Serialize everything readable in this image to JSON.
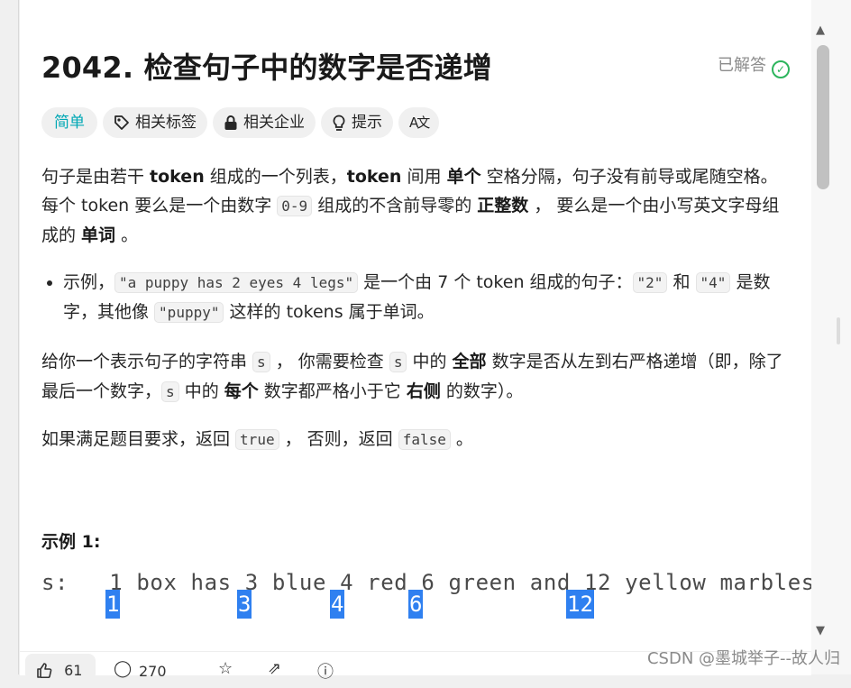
{
  "problem": {
    "title": "2042. 检查句子中的数字是否递增",
    "status": "已解答"
  },
  "tags": {
    "difficulty": "简单",
    "topics": "相关标签",
    "companies": "相关企业",
    "hint": "提示",
    "translate_glyph": "A文"
  },
  "description": {
    "p1": {
      "a": "句子是由若干 ",
      "b": "token",
      "c": " 组成的一个列表，",
      "d": "token",
      "e": " 间用 ",
      "f": "单个",
      "g": " 空格分隔，句子没有前导或尾随空格。每个 token 要么是一个由数字 ",
      "h": "0-9",
      "i": " 组成的不含前导零的 ",
      "j": "正整数",
      "k": " ， 要么是一个由小写英文字母组成的 ",
      "l": "单词",
      "m": " 。"
    },
    "bullet": {
      "a": "示例，",
      "b": "\"a puppy has 2 eyes 4 legs\"",
      "c": " 是一个由 7 个 token 组成的句子：",
      "d": "\"2\"",
      "e": " 和 ",
      "f": "\"4\"",
      "g": " 是数字，其他像 ",
      "h": "\"puppy\"",
      "i": " 这样的 tokens 属于单词。"
    },
    "p2": {
      "a": "给你一个表示句子的字符串 ",
      "b": "s",
      "c": " ， 你需要检查 ",
      "d": "s",
      "e": " 中的 ",
      "f": "全部",
      "g": " 数字是否从左到右严格递增（即，除了最后一个数字，",
      "h": "s",
      "i": " 中的 ",
      "j": "每个",
      "k": " 数字都严格小于它 ",
      "l": "右侧",
      "m": " 的数字）。"
    },
    "p3": {
      "a": "如果满足题目要求，返回 ",
      "b": "true",
      "c": " ， 否则，返回 ",
      "d": "false",
      "e": " 。"
    }
  },
  "example": {
    "title": "示例 1:",
    "line": "s:   1 box has 3 blue 4 red 6 green and 12 yellow marbles",
    "highlights": [
      "1",
      "3",
      "4",
      "6",
      "12"
    ]
  },
  "footer": {
    "likes": "61",
    "comments": "270",
    "watermark": "CSDN @墨城举子--故人归"
  }
}
